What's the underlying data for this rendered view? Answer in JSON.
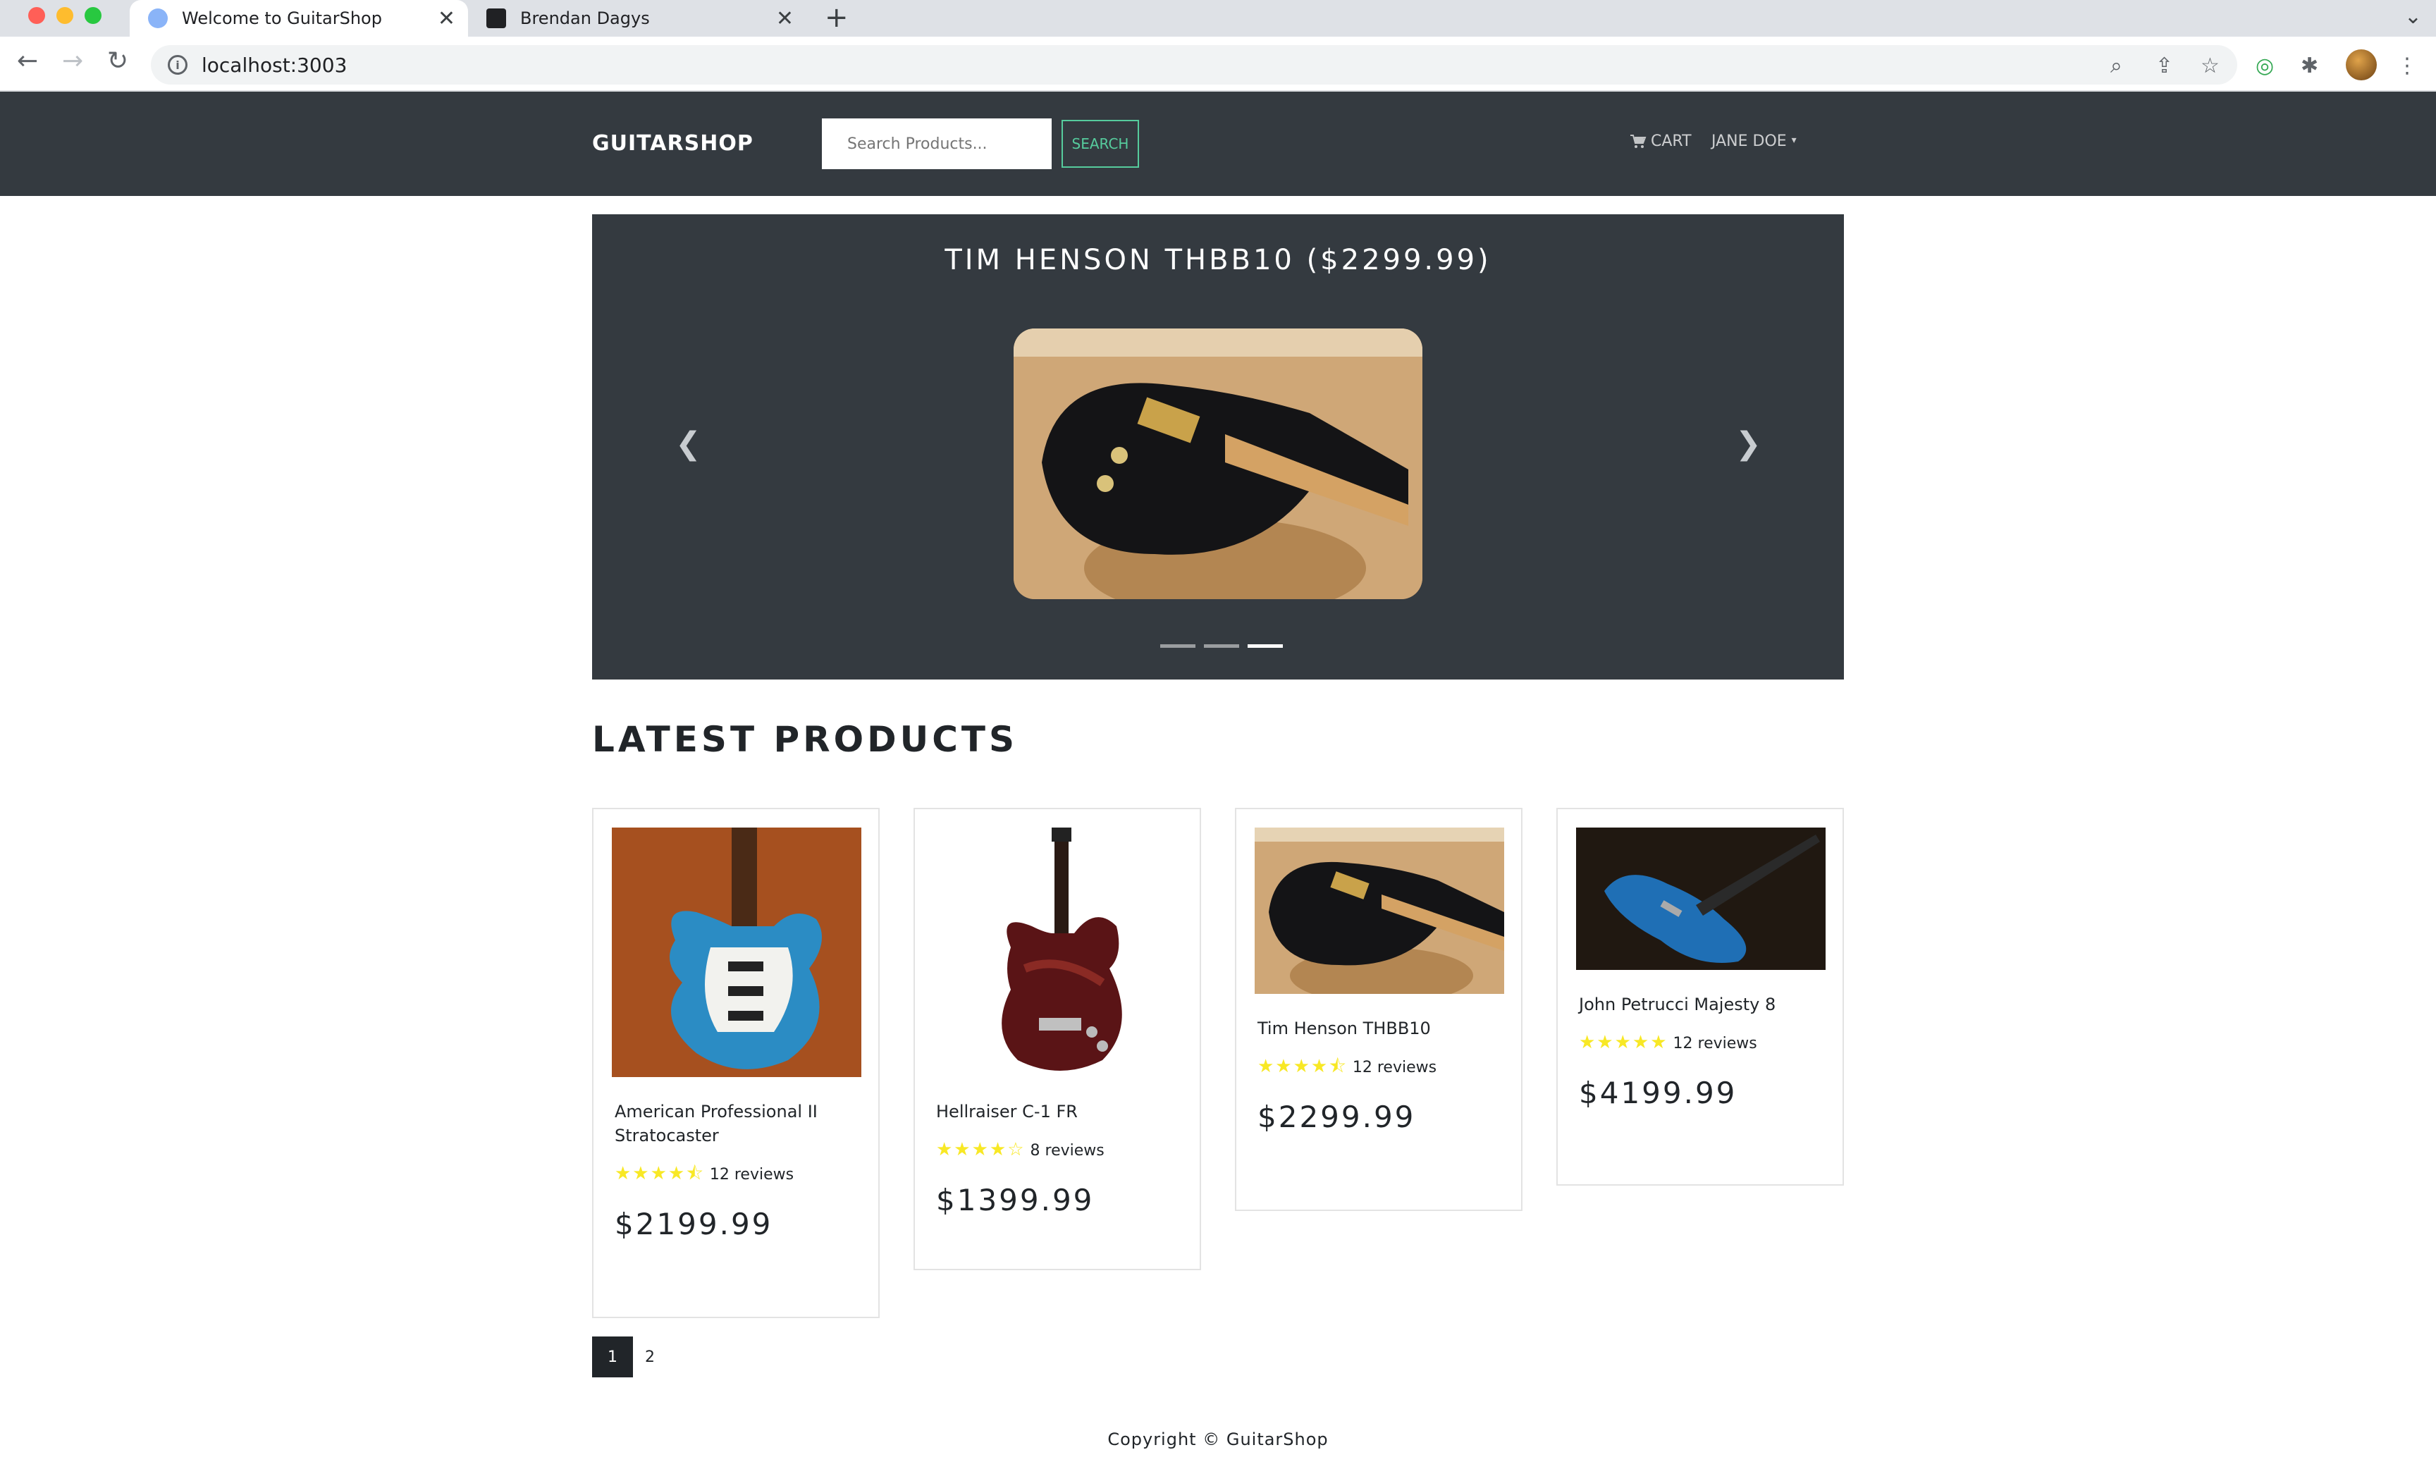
{
  "browser": {
    "tabs": [
      {
        "title": "Welcome to GuitarShop",
        "active": true
      },
      {
        "title": "Brendan Dagys",
        "active": false
      }
    ],
    "url": "localhost:3003"
  },
  "navbar": {
    "brand": "GUITARSHOP",
    "search_placeholder": "Search Products...",
    "search_button": "SEARCH",
    "cart_label": "CART",
    "user_label": "JANE DOE"
  },
  "carousel": {
    "title": "TIM HENSON THBB10 ($2299.99)",
    "active_index": 2,
    "slide_count": 3
  },
  "section": {
    "title": "LATEST PRODUCTS"
  },
  "products": [
    {
      "name": "American Professional II Stratocaster",
      "rating": 4.5,
      "reviews": "12 reviews",
      "price": "$2199.99"
    },
    {
      "name": "Hellraiser C-1 FR",
      "rating": 4,
      "reviews": "8 reviews",
      "price": "$1399.99"
    },
    {
      "name": "Tim Henson THBB10",
      "rating": 4.5,
      "reviews": "12 reviews",
      "price": "$2299.99"
    },
    {
      "name": "John Petrucci Majesty 8",
      "rating": 5,
      "reviews": "12 reviews",
      "price": "$4199.99"
    }
  ],
  "pagination": {
    "pages": [
      "1",
      "2"
    ],
    "active": "1"
  },
  "footer": {
    "text": "Copyright © GuitarShop"
  },
  "colors": {
    "navbar": "#343a40",
    "accent": "#56cc9d",
    "star": "#f8e825"
  },
  "stars": {
    "card0": "★★★★⯪",
    "card1": "★★★★☆",
    "card2": "★★★★⯪",
    "card3": "★★★★★"
  }
}
